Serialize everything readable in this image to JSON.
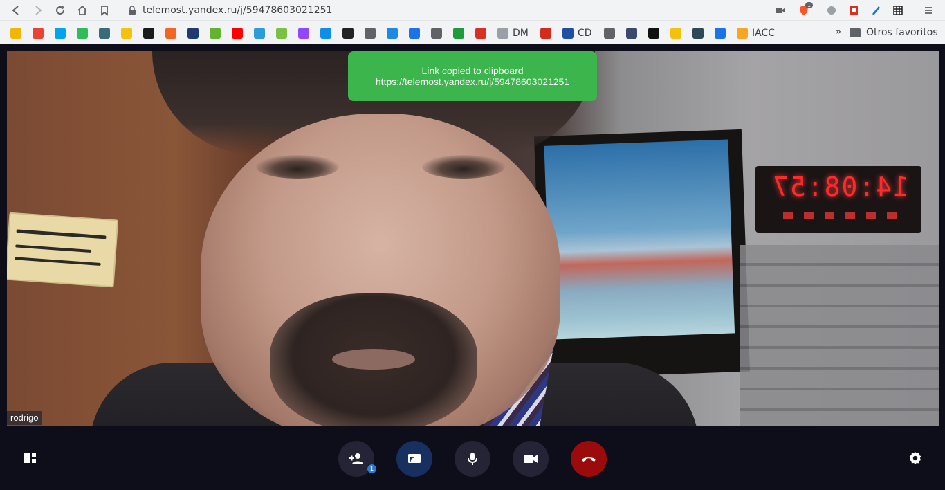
{
  "browser": {
    "url": "telemost.yandex.ru/j/59478603021251",
    "ext_badge": "1",
    "bookmarks": [
      {
        "name": "gmail-icon",
        "label": "",
        "color": "#f2b705"
      },
      {
        "name": "gmail-m-icon",
        "label": "",
        "color": "#ea4335"
      },
      {
        "name": "microsoft-icon",
        "label": "",
        "color": "#00a4ef"
      },
      {
        "name": "one-icon",
        "label": "",
        "color": "#2ebd59"
      },
      {
        "name": "flag-icon",
        "label": "",
        "color": "#3a6b7a"
      },
      {
        "name": "e-icon",
        "label": "",
        "color": "#f4c20d"
      },
      {
        "name": "c-icon",
        "label": "",
        "color": "#1b1b1b"
      },
      {
        "name": "orange-icon",
        "label": "",
        "color": "#f26522"
      },
      {
        "name": "bank-icon",
        "label": "",
        "color": "#1f3a6e"
      },
      {
        "name": "rt-icon",
        "label": "",
        "color": "#64b32e"
      },
      {
        "name": "youtube-icon",
        "label": "",
        "color": "#ff0000"
      },
      {
        "name": "arrow-icon",
        "label": "",
        "color": "#2d9cdb"
      },
      {
        "name": "camera-icon",
        "label": "",
        "color": "#7ac143"
      },
      {
        "name": "twitch-icon",
        "label": "",
        "color": "#9146ff"
      },
      {
        "name": "teamviewer-icon",
        "label": "",
        "color": "#0e8ee9"
      },
      {
        "name": "car-icon",
        "label": "",
        "color": "#222222"
      },
      {
        "name": "globe-icon",
        "label": "",
        "color": "#5f6368"
      },
      {
        "name": "plane-icon",
        "label": "",
        "color": "#1e88e5"
      },
      {
        "name": "t-icon",
        "label": "",
        "color": "#1a73e8"
      },
      {
        "name": "globe2-icon",
        "label": "",
        "color": "#5f6368"
      },
      {
        "name": "lock-green-icon",
        "label": "",
        "color": "#1e9b3a"
      },
      {
        "name": "s-icon",
        "label": "",
        "color": "#d93025"
      },
      {
        "name": "dm-icon",
        "label": "DM",
        "color": "#9aa0a6"
      },
      {
        "name": "flag-chile-icon",
        "label": "",
        "color": "#d52b1e"
      },
      {
        "name": "cd-icon",
        "label": "CD",
        "color": "#1f4ea3"
      },
      {
        "name": "globe3-icon",
        "label": "",
        "color": "#5f6368"
      },
      {
        "name": "shield-icon",
        "label": "",
        "color": "#3a4a6b"
      },
      {
        "name": "check-icon",
        "label": "",
        "color": "#111111"
      },
      {
        "name": "pag-icon",
        "label": "",
        "color": "#f4c20d"
      },
      {
        "name": "at-icon",
        "label": "",
        "color": "#2f4858"
      },
      {
        "name": "infinity-icon",
        "label": "",
        "color": "#1a73e8"
      },
      {
        "name": "iacc-icon",
        "label": "IACC",
        "color": "#f6a623"
      }
    ],
    "more": "»",
    "other_favorites": "Otros favoritos"
  },
  "toast": {
    "line1": "Link copied to clipboard",
    "line2": "https://telemost.yandex.ru/j/59478603021251"
  },
  "participant": {
    "name": "rodrigo"
  },
  "video_scene": {
    "clock_text": "14:08:57"
  },
  "controls": {
    "invite_badge": "1",
    "colors": {
      "button_bg": "#252437",
      "screen_share_bg": "#173060",
      "end_call_bg": "#9b0b0b"
    }
  }
}
